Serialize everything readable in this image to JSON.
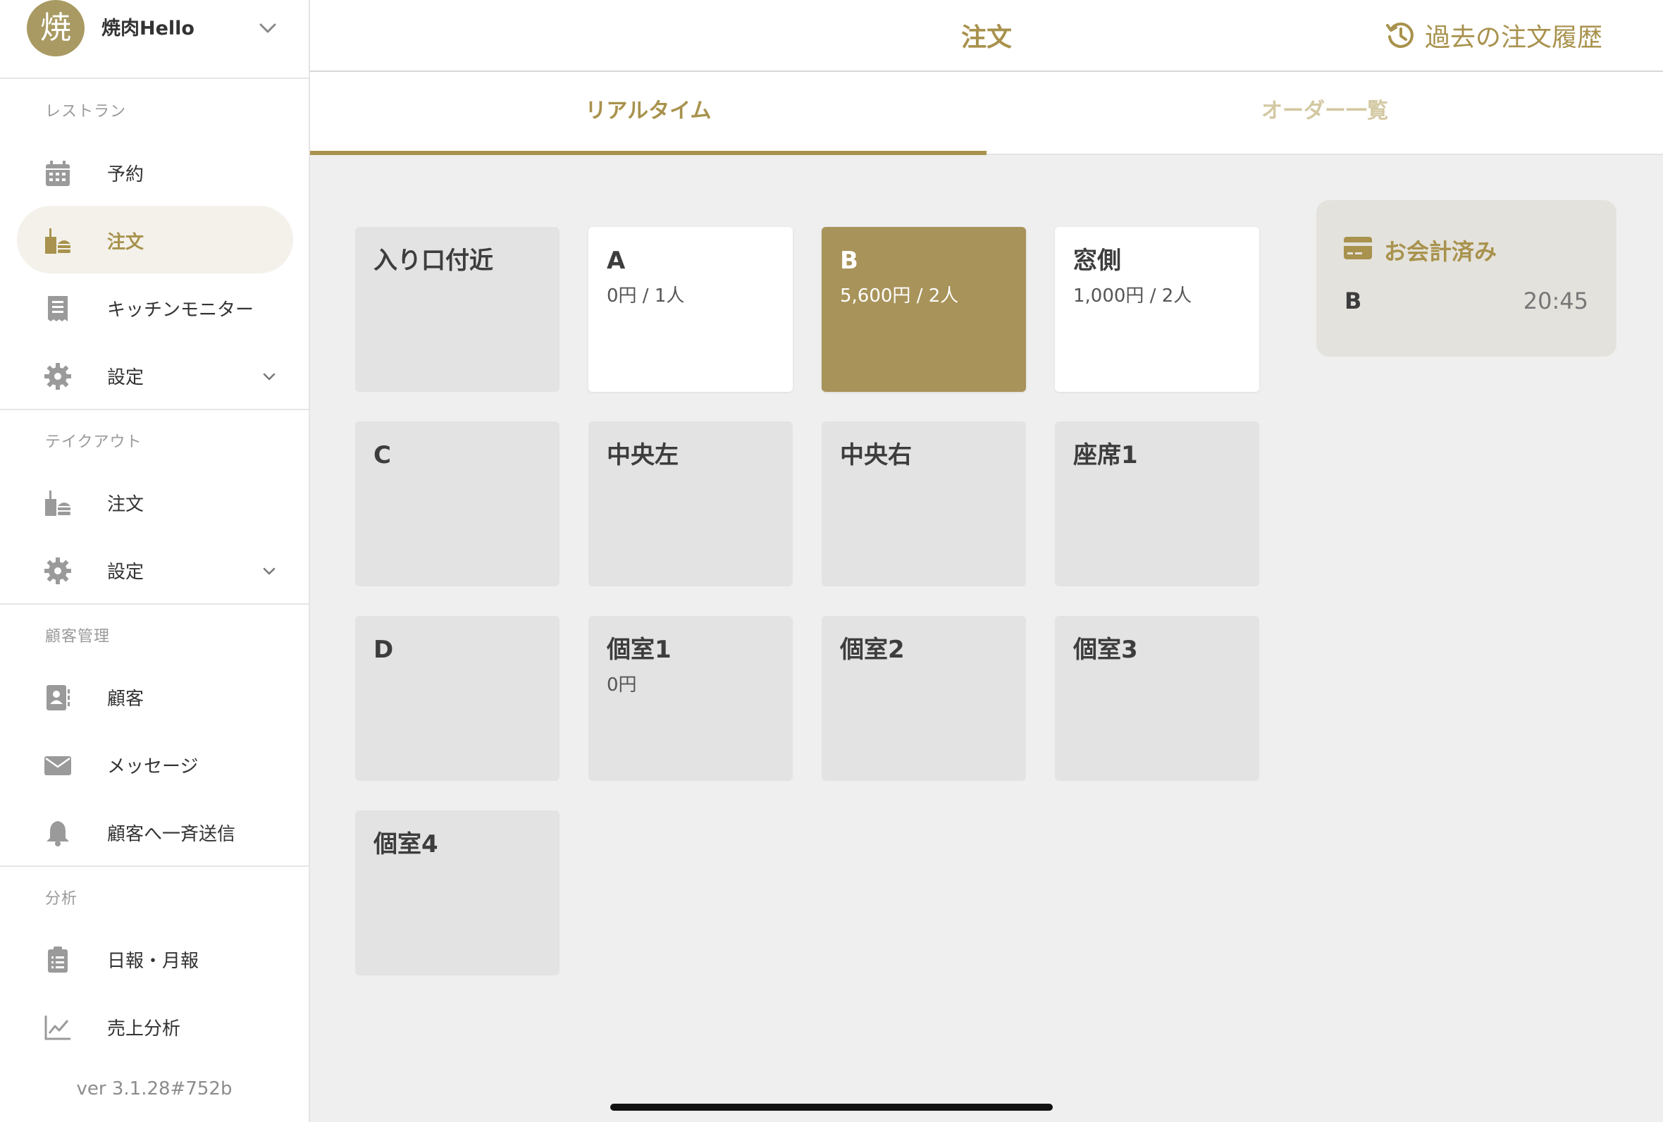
{
  "sidebar": {
    "avatar_char": "焼",
    "shop_name": "焼肉Hello",
    "sections": {
      "restaurant": "レストラン",
      "takeout": "テイクアウト",
      "crm": "顧客管理",
      "analytics": "分析"
    },
    "items": {
      "reservation": "予約",
      "order": "注文",
      "kitchen": "キッチンモニター",
      "settings": "設定",
      "takeout_order": "注文",
      "takeout_settings": "設定",
      "customers": "顧客",
      "messages": "メッセージ",
      "broadcast": "顧客へ一斉送信",
      "reports": "日報・月報",
      "sales": "売上分析"
    },
    "version": "ver 3.1.28#752b"
  },
  "header": {
    "title": "注文",
    "history_label": "過去の注文履歴"
  },
  "tabs": {
    "realtime": "リアルタイム",
    "orders": "オーダー一覧"
  },
  "tables": [
    {
      "name": "入り口付近",
      "info": ""
    },
    {
      "name": "A",
      "info": "0円 / 1人"
    },
    {
      "name": "B",
      "info": "5,600円 / 2人"
    },
    {
      "name": "窓側",
      "info": "1,000円 / 2人"
    },
    {
      "name": "C",
      "info": ""
    },
    {
      "name": "中央左",
      "info": ""
    },
    {
      "name": "中央右",
      "info": ""
    },
    {
      "name": "座席1",
      "info": ""
    },
    {
      "name": "D",
      "info": ""
    },
    {
      "name": "個室1",
      "info": "0円"
    },
    {
      "name": "個室2",
      "info": ""
    },
    {
      "name": "個室3",
      "info": ""
    },
    {
      "name": "個室4",
      "info": ""
    }
  ],
  "paid": {
    "title": "お会計済み",
    "rows": [
      {
        "table": "B",
        "time": "20:45"
      }
    ]
  },
  "colors": {
    "accent": "#a8924d",
    "selected_table": "#a8935a",
    "occupied_table": "#ffffff",
    "empty_table": "#e3e3e3"
  }
}
